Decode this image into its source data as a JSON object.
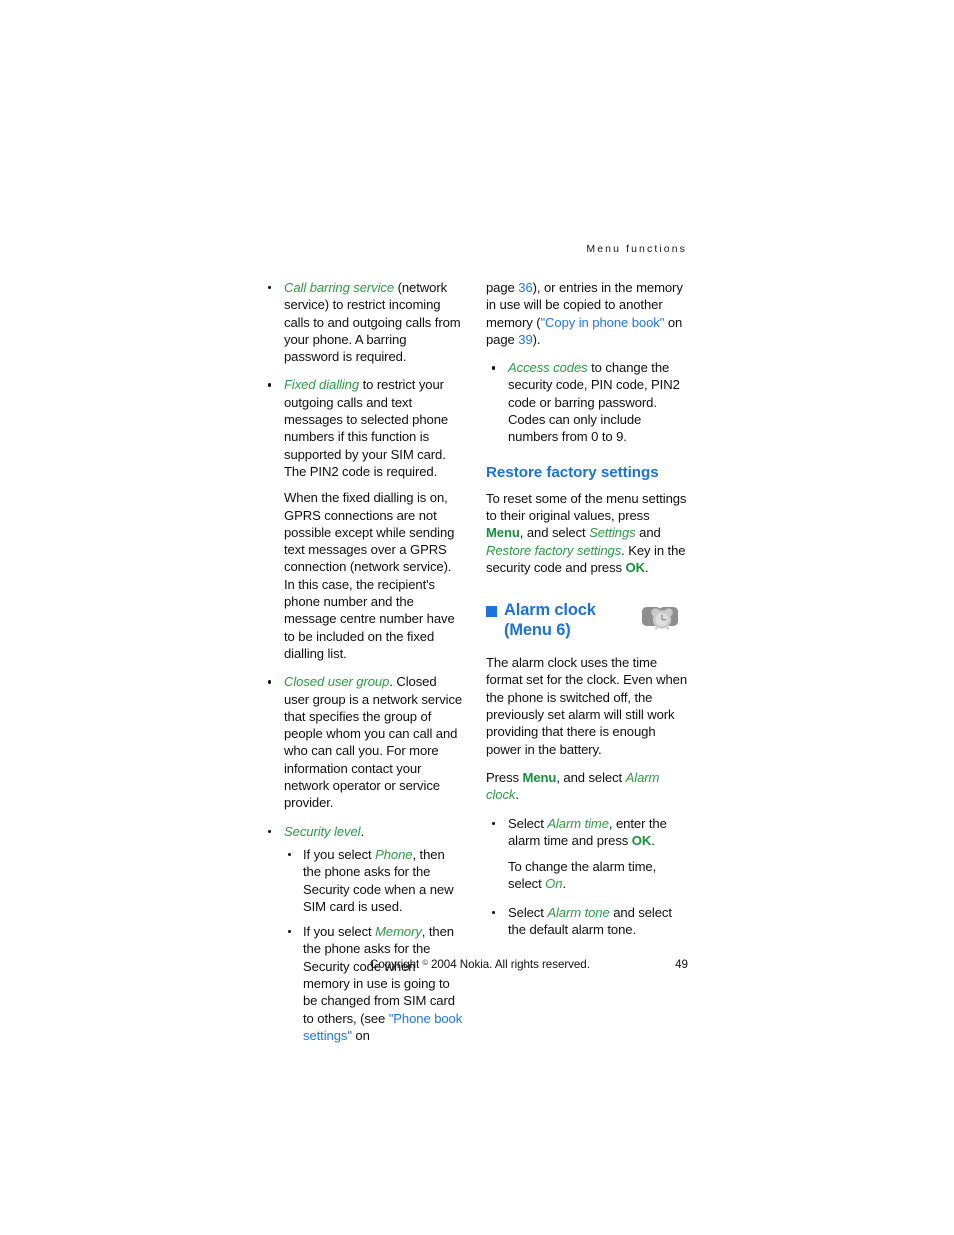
{
  "header": {
    "running_title": "Menu functions"
  },
  "left_column": {
    "bullets": [
      {
        "id": "call-barring-service",
        "emphasis": "Call barring service",
        "text_after": " (network service) to restrict incoming calls to and outgoing calls from your phone. A barring password is required."
      },
      {
        "id": "fixed-dialling",
        "emphasis": "Fixed dialling",
        "text_after": " to restrict your outgoing calls and text messages to selected phone numbers if this function is supported by your SIM card. The PIN2 code is required.",
        "continuation": "When the fixed dialling is on, GPRS connections are not possible except while sending text messages over a GPRS connection (network service). In this case, the recipient's phone number and the message centre number have to be included on the fixed dialling list."
      },
      {
        "id": "closed-user-group",
        "emphasis": "Closed user group",
        "text_after": ". Closed user group is a network service that specifies the group of people whom you can call and who can call you. For more information contact your network operator or service provider."
      },
      {
        "id": "security-level",
        "emphasis": "Security level",
        "text_after": "."
      }
    ],
    "security_level_subbullets": [
      {
        "id": "security-level-phone",
        "before": "If you select ",
        "emphasis": "Phone",
        "after": ", then the phone asks for the Security code when a new SIM card is used."
      },
      {
        "id": "security-level-memory",
        "before": "If you select ",
        "emphasis": "Memory",
        "after": ", then the phone asks for the Security code when memory in use is going to be changed from SIM card to others, (see ",
        "link": "\"Phone book settings\"",
        "after_link": " on"
      }
    ]
  },
  "right_column": {
    "continued_paragraph": {
      "before_page": "page ",
      "page_link_1": "36",
      "middle": "), or entries in the memory in use will be copied to another memory (",
      "link_2_line1": "\"Copy in",
      "link_2_line2": "phone book\"",
      "after_link": " on page ",
      "page_link_2": "39",
      "tail": ")."
    },
    "access_codes_bullet": {
      "id": "access-codes",
      "emphasis": "Access codes",
      "text_after": " to change the security code, PIN code, PIN2 code or barring password. Codes can only include numbers from 0 to 9."
    },
    "restore_section": {
      "heading": "Restore factory settings",
      "p1_part1": "To reset some of the menu settings to their original values, press ",
      "p1_key1": "Menu",
      "p1_part2": ", and select ",
      "p1_menu1": "Settings",
      "p1_part3": " and ",
      "p1_menu2": "Restore factory settings",
      "p1_part4": ". Key in the security code and press ",
      "p1_key2": "OK",
      "p1_part5": "."
    },
    "alarm_section": {
      "heading_line1": "Alarm clock",
      "heading_line2": "(Menu 6)",
      "icon_name": "alarm-clock-icon",
      "intro": "The alarm clock uses the time format set for the clock. Even when the phone is switched off, the previously set alarm will still work providing that there is enough power in the battery.",
      "press_part1": "Press ",
      "press_key": "Menu",
      "press_part2": ", and select ",
      "press_menu": "Alarm clock",
      "press_part3": ".",
      "bullets": [
        {
          "id": "alarm-time",
          "before": "Select ",
          "emphasis": "Alarm time",
          "middle": ", enter the alarm time and press ",
          "key": "OK",
          "after": ".",
          "continuation_before": "To change the alarm time, select ",
          "continuation_emphasis": "On",
          "continuation_after": "."
        },
        {
          "id": "alarm-tone",
          "before": "Select ",
          "emphasis": "Alarm tone",
          "middle": " and select the default alarm tone.",
          "key": "",
          "after": ""
        }
      ]
    }
  },
  "footer": {
    "copyright_prefix": "Copyright ",
    "copyright_symbol": "©",
    "copyright_suffix": " 2004 Nokia. All rights reserved.",
    "page_number": "49"
  },
  "colors": {
    "heading_blue": "#1b72d8",
    "link_blue": "#2277dd",
    "menu_green": "#2d9c43",
    "key_green": "#18903a",
    "text_black": "#111111",
    "icon_gray": "#8c8c8c"
  }
}
